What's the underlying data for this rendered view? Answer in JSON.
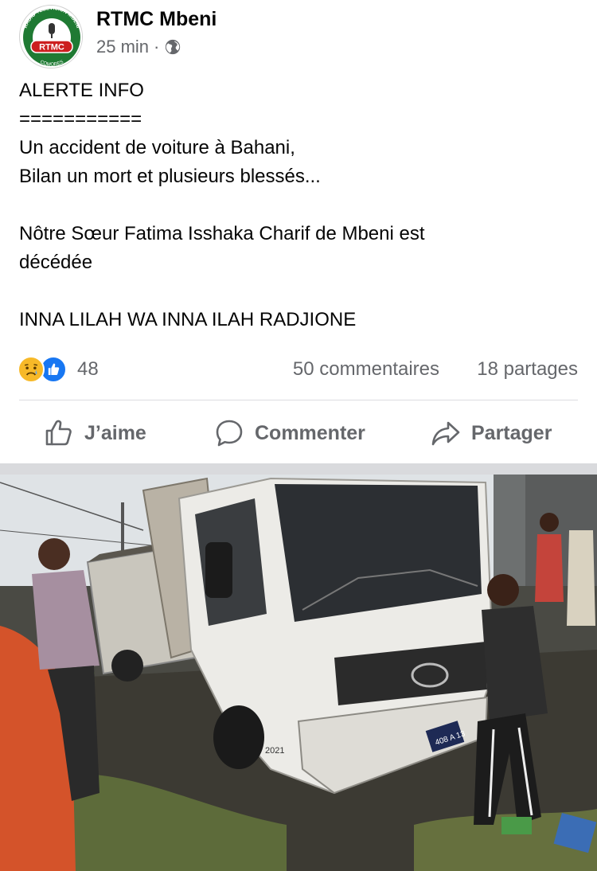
{
  "post": {
    "page_name": "RTMC Mbeni",
    "time": "25 min",
    "separator": "·",
    "privacy_icon": "globe-icon",
    "avatar": {
      "ring_top_text": "RADIO TELEVISION MBENI",
      "center_text": "RTMC",
      "bottom_text": "COMORES",
      "colors": {
        "ring": "#1f7a33",
        "center": "#cc1f1f"
      }
    },
    "text_lines": [
      "ALERTE INFO",
      "===========",
      "Un accident de voiture à Bahani,",
      "Bilan un mort et plusieurs blessés...",
      "",
      "Nôtre Sœur Fatima Isshaka Charif de Mbeni est",
      "décédée",
      "",
      "INNA LILAH WA INNA ILAH RADJIONE"
    ]
  },
  "stats": {
    "reactions": [
      "sad-reaction-icon",
      "like-reaction-icon"
    ],
    "reaction_count": "48",
    "comments": "50 commentaires",
    "shares": "18 partages"
  },
  "actions": {
    "like": {
      "label": "J’aime",
      "icon": "thumbs-up-icon"
    },
    "comment": {
      "label": "Commenter",
      "icon": "comment-bubble-icon"
    },
    "share": {
      "label": "Partager",
      "icon": "share-arrow-icon"
    }
  },
  "photo": {
    "plate_text": "408 A 13",
    "cab_marking": "2021"
  },
  "colors": {
    "text": "#050505",
    "secondary_text": "#65676b",
    "like_blue": "#1877f2",
    "sad_yellow": "#f7b928",
    "divider": "#dcdde1"
  }
}
